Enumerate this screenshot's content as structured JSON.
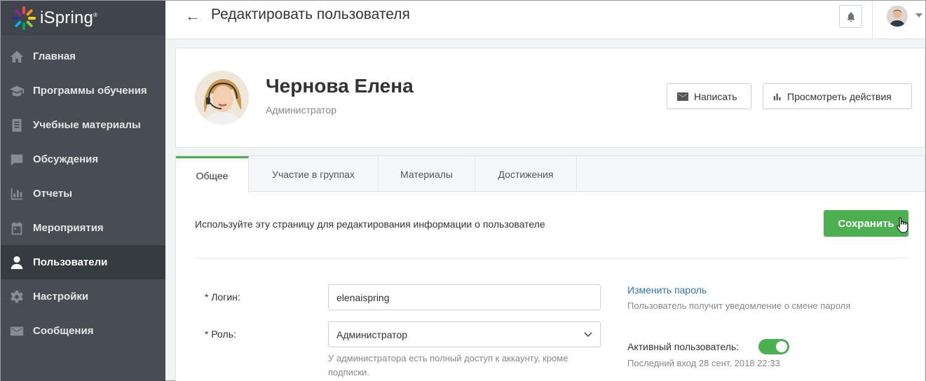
{
  "brand": {
    "name": "iSpring",
    "mark": "®"
  },
  "sidebar": {
    "items": [
      {
        "label": "Главная",
        "icon": "home-icon"
      },
      {
        "label": "Программы обучения",
        "icon": "graduation-cap-icon"
      },
      {
        "label": "Учебные материалы",
        "icon": "document-list-icon"
      },
      {
        "label": "Обсуждения",
        "icon": "chat-bubble-icon"
      },
      {
        "label": "Отчеты",
        "icon": "bar-chart-icon"
      },
      {
        "label": "Мероприятия",
        "icon": "calendar-icon"
      },
      {
        "label": "Пользователи",
        "icon": "user-icon",
        "active": true
      },
      {
        "label": "Настройки",
        "icon": "gear-icon"
      },
      {
        "label": "Сообщения",
        "icon": "envelope-icon"
      }
    ]
  },
  "header": {
    "title": "Редактировать пользователя",
    "back_icon": "←"
  },
  "profile": {
    "name": "Чернова Елена",
    "role": "Администратор",
    "write_label": "Написать",
    "actions_label": "Просмотреть действия"
  },
  "tabs": [
    {
      "label": "Общее",
      "active": true
    },
    {
      "label": "Участие в группах"
    },
    {
      "label": "Материалы"
    },
    {
      "label": "Достижения"
    }
  ],
  "form": {
    "hint": "Используйте эту страницу для редактирования информации о пользователе",
    "save_label": "Сохранить",
    "login_label": "* Логин:",
    "login_value": "elenaispring",
    "role_label": "* Роль:",
    "role_value": "Администратор",
    "role_note": "У администратора есть полный доступ к аккаунту, кроме подписки.",
    "change_password": "Изменить пароль",
    "password_note": "Пользователь получит уведомление о смене пароля",
    "active_label": "Активный пользователь:",
    "active_on": true,
    "last_login": "Последний вход 28 сент. 2018 22:33"
  },
  "colors": {
    "accent": "#4cb051",
    "sidebar": "#474d53",
    "sidebar_active": "#363b40",
    "link": "#2d74b8"
  }
}
